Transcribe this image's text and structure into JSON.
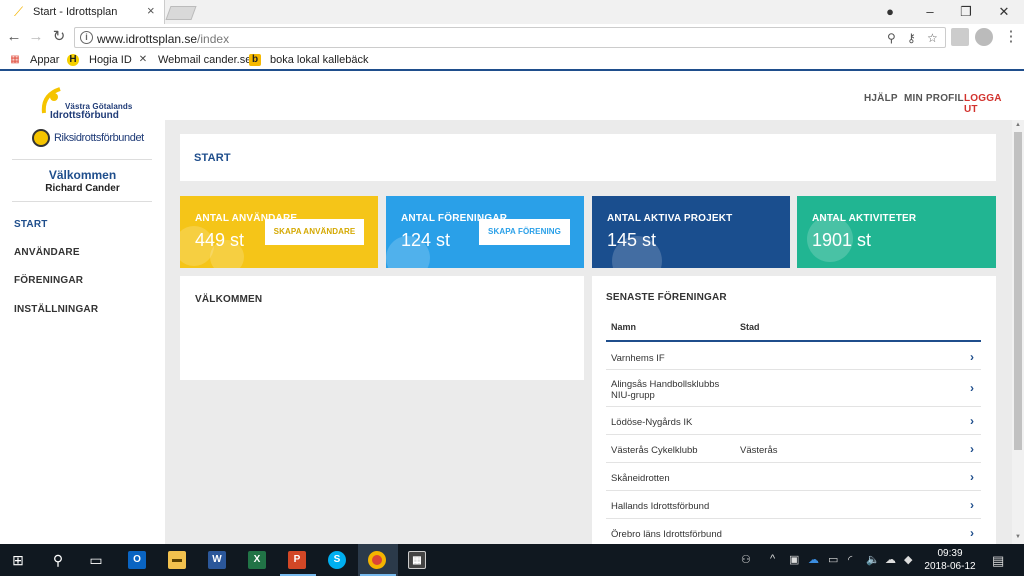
{
  "browser": {
    "tab_title": "Start - Idrottsplan",
    "url_host": "www.idrottsplan.se",
    "url_path": "/index",
    "bookmarks": [
      "Appar",
      "Hogia ID",
      "Webmail cander.se",
      "boka lokal kallebäck"
    ]
  },
  "sidebar": {
    "logo_line1": "Västra Götalands",
    "logo_line2": "Idrottsförbund",
    "logo2_text": "Riksidrottsförbundet",
    "welcome": "Välkommen",
    "user_name": "Richard Cander",
    "nav": [
      "START",
      "ANVÄNDARE",
      "FÖRENINGAR",
      "INSTÄLLNINGAR"
    ]
  },
  "topnav": {
    "help": "HJÄLP",
    "profile": "MIN PROFIL",
    "logout": "LOGGA UT"
  },
  "page_title": "START",
  "stats": [
    {
      "label": "ANTAL ANVÄNDARE",
      "value": "449 st",
      "button": "SKAPA ANVÄNDARE",
      "color": "#f5c518"
    },
    {
      "label": "ANTAL FÖRENINGAR",
      "value": "124 st",
      "button": "SKAPA FÖRENING",
      "color": "#2aa0e8"
    },
    {
      "label": "ANTAL AKTIVA PROJEKT",
      "value": "145 st",
      "color": "#1a4e8e"
    },
    {
      "label": "ANTAL AKTIVITETER",
      "value": "1901 st",
      "color": "#21b592"
    }
  ],
  "welcome_card_title": "VÄLKOMMEN",
  "latest": {
    "title": "SENASTE FÖRENINGAR",
    "col_name": "Namn",
    "col_city": "Stad",
    "rows": [
      {
        "name": "Varnhems IF",
        "city": ""
      },
      {
        "name": "Alingsås Handbollsklubbs NIU-grupp",
        "city": ""
      },
      {
        "name": "Lödöse-Nygårds IK",
        "city": ""
      },
      {
        "name": "Västerås Cykelklubb",
        "city": "Västerås"
      },
      {
        "name": "Skåneidrotten",
        "city": ""
      },
      {
        "name": "Hallands Idrottsförbund",
        "city": ""
      },
      {
        "name": "Örebro läns Idrottsförbund",
        "city": ""
      }
    ]
  },
  "taskbar": {
    "time": "09:39",
    "date": "2018-06-12",
    "apps": [
      "outlook-icon",
      "file-explorer-icon",
      "word-icon",
      "excel-icon",
      "powerpoint-icon",
      "skype-icon",
      "chrome-icon",
      "calculator-icon"
    ]
  }
}
